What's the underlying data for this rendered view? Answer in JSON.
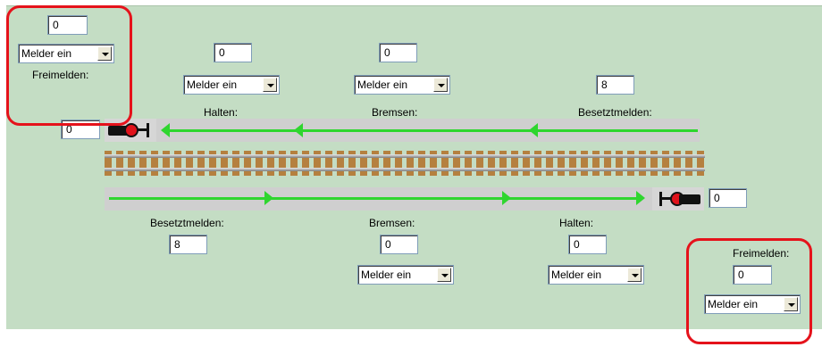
{
  "top": {
    "free": {
      "value": "0",
      "select": "Melder ein",
      "label": "Freimelden:"
    },
    "halt": {
      "value": "0",
      "select": "Melder ein",
      "label": "Halten:"
    },
    "brake": {
      "value": "0",
      "select": "Melder ein",
      "label": "Bremsen:"
    },
    "busy": {
      "value": "8",
      "label": "Besetztmelden:"
    },
    "signal_value": "0"
  },
  "bottom": {
    "busy": {
      "label": "Besetztmelden:",
      "value": "8"
    },
    "brake": {
      "label": "Bremsen:",
      "value": "0",
      "select": "Melder ein"
    },
    "halt": {
      "label": "Halten:",
      "value": "0",
      "select": "Melder ein"
    },
    "free": {
      "label": "Freimelden:",
      "value": "0",
      "select": "Melder ein"
    },
    "signal_value": "0"
  },
  "icons": {
    "signal_left": "track-signal-icon",
    "signal_right": "track-signal-icon",
    "dropdown": "chevron-down-icon"
  },
  "colors": {
    "background": "#c4ddc4",
    "direction_arrow": "#2fd62f",
    "highlight": "#e5121b",
    "signal_red": "#e0121b"
  }
}
